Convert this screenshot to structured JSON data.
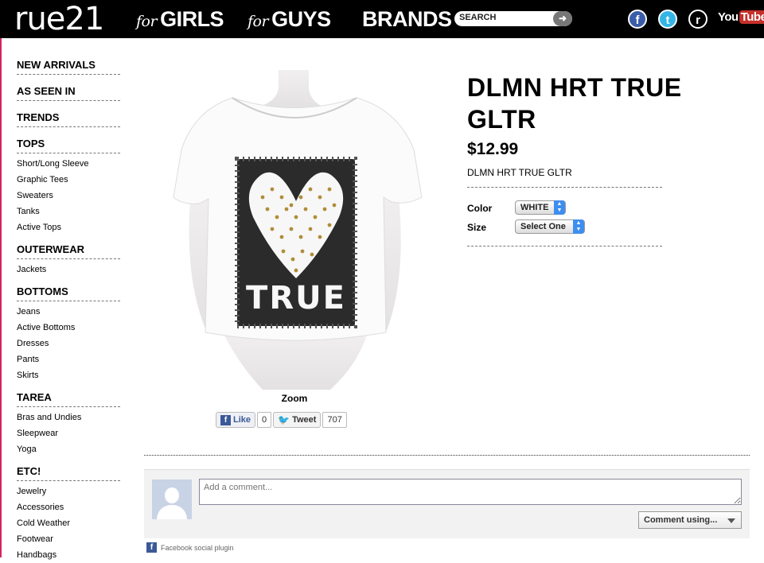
{
  "header": {
    "logo": "rue21",
    "nav": [
      {
        "prefix": "for",
        "label": "GIRLS"
      },
      {
        "prefix": "for",
        "label": "GUYS"
      },
      {
        "prefix": "",
        "label": "BRANDS"
      }
    ],
    "search": {
      "placeholder": "SEARCH",
      "go_icon": "arrow-right-icon"
    },
    "social": {
      "facebook": "f",
      "twitter": "t",
      "rue": "r",
      "youtube_you": "You",
      "youtube_tube": "Tube"
    }
  },
  "sidebar": {
    "sections": [
      {
        "label": "NEW ARRIVALS",
        "items": []
      },
      {
        "label": "AS SEEN IN",
        "items": []
      },
      {
        "label": "TRENDS",
        "items": []
      },
      {
        "label": "TOPS",
        "items": [
          "Short/Long Sleeve",
          "Graphic Tees",
          "Sweaters",
          "Tanks",
          "Active Tops"
        ]
      },
      {
        "label": "OUTERWEAR",
        "items": [
          "Jackets"
        ]
      },
      {
        "label": "BOTTOMS",
        "items": [
          "Jeans",
          "Active Bottoms",
          "Dresses",
          "Pants",
          "Skirts"
        ]
      },
      {
        "label": "TAREA",
        "items": [
          "Bras and Undies",
          "Sleepwear",
          "Yoga"
        ]
      },
      {
        "label": "ETC!",
        "items": [
          "Jewelry",
          "Accessories",
          "Cold Weather",
          "Footwear",
          "Handbags"
        ]
      }
    ]
  },
  "product": {
    "title": "DLMN HRT TRUE GLTR",
    "price": "$12.99",
    "description": "DLMN HRT TRUE GLTR",
    "graphic_text": "TRUE",
    "zoom_label": "Zoom",
    "options": {
      "color_label": "Color",
      "color_value": "WHITE",
      "size_label": "Size",
      "size_value": "Select One"
    }
  },
  "share": {
    "like_label": "Like",
    "like_count": "0",
    "tweet_label": "Tweet",
    "tweet_count": "707"
  },
  "comments": {
    "placeholder": "Add a comment...",
    "comment_using": "Comment using...",
    "plugin_label": "Facebook social plugin"
  },
  "colors": {
    "brand_pink": "#d6245c",
    "facebook_blue": "#3b5998",
    "header_bg": "#000000"
  }
}
